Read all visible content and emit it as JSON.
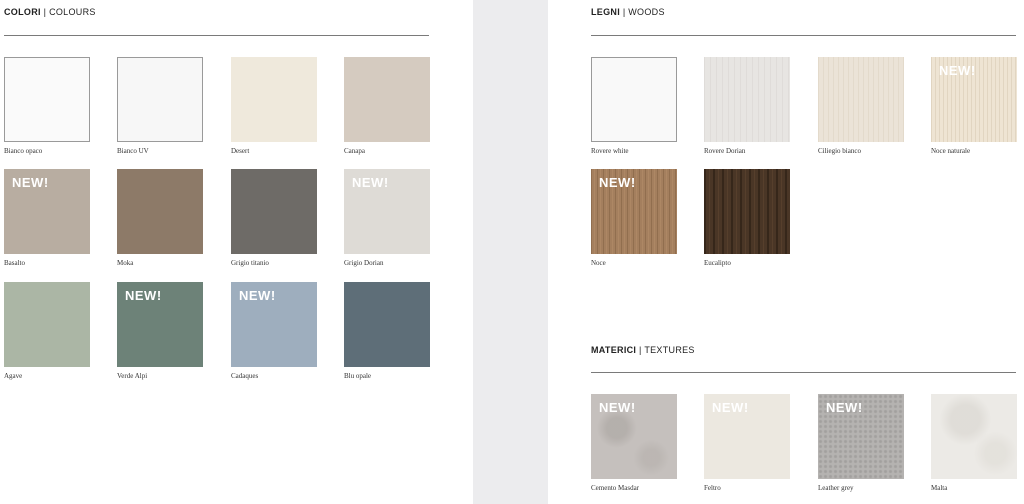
{
  "colours": {
    "title_bold": "COLORI",
    "title_rest": "| COLOURS",
    "swatches": [
      {
        "name": "Bianco opaco",
        "color": "#fafafa",
        "new": false,
        "border": true
      },
      {
        "name": "Bianco UV",
        "color": "#f7f7f7",
        "new": false,
        "border": true
      },
      {
        "name": "Desert",
        "color": "#efe9dc",
        "new": false,
        "border": false
      },
      {
        "name": "Canapa",
        "color": "#d5cbc0",
        "new": false,
        "border": false
      },
      {
        "name": "Basalto",
        "color": "#b8ada1",
        "new": true,
        "border": false
      },
      {
        "name": "Moka",
        "color": "#8d7a68",
        "new": false,
        "border": false
      },
      {
        "name": "Grigio titanio",
        "color": "#6e6b67",
        "new": false,
        "border": false
      },
      {
        "name": "Grigio Dorian",
        "color": "#dedbd6",
        "new": true,
        "border": false
      },
      {
        "name": "Agave",
        "color": "#abb6a5",
        "new": false,
        "border": false
      },
      {
        "name": "Verde Alpi",
        "color": "#6d8278",
        "new": true,
        "border": false
      },
      {
        "name": "Cadaques",
        "color": "#9eaebe",
        "new": true,
        "border": false
      },
      {
        "name": "Blu opale",
        "color": "#5e6e78",
        "new": false,
        "border": false
      }
    ]
  },
  "woods": {
    "title_bold": "LEGNI",
    "title_rest": "| WOODS",
    "swatches": [
      {
        "name": "Rovere white",
        "color": "#f9f9f9",
        "new": false,
        "border": true
      },
      {
        "name": "Rovere Dorian",
        "color": "#e7e5e2",
        "new": false,
        "border": false
      },
      {
        "name": "Ciliegio bianco",
        "color": "#ebe3d7",
        "new": false,
        "border": false
      },
      {
        "name": "Noce naturale",
        "color": "#eee4d3",
        "new": true,
        "border": false
      },
      {
        "name": "Noce",
        "color": "#a47f5e",
        "new": true,
        "border": false
      },
      {
        "name": "Eucalipto",
        "color": "#4a3626",
        "new": false,
        "border": false
      }
    ]
  },
  "textures": {
    "title_bold": "MATERICI",
    "title_rest": "| TEXTURES",
    "swatches": [
      {
        "name": "Cemento Masdar",
        "color": "#c5c0bd",
        "new": true,
        "border": false
      },
      {
        "name": "Feltro",
        "color": "#ece8e0",
        "new": true,
        "border": false
      },
      {
        "name": "Leather grey",
        "color": "#b5b3b1",
        "new": true,
        "border": false
      },
      {
        "name": "Malta",
        "color": "#eceae6",
        "new": false,
        "border": false
      }
    ]
  },
  "new_badge": "NEW!"
}
